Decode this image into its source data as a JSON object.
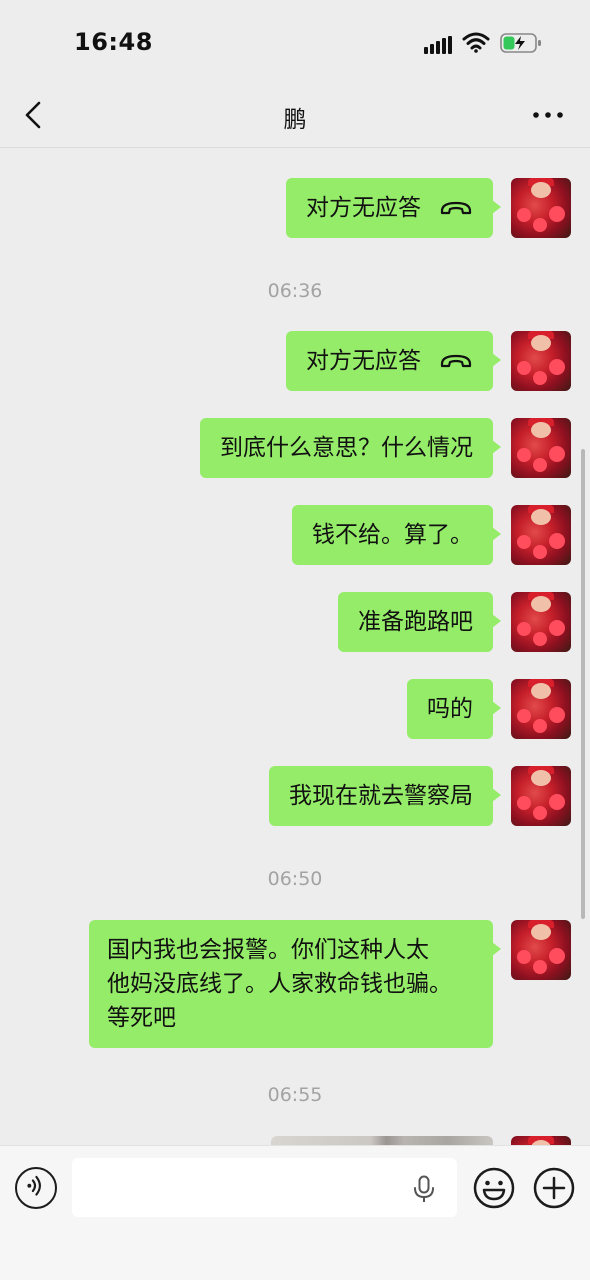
{
  "status_bar": {
    "time": "16:48"
  },
  "nav": {
    "title": "鹏"
  },
  "messages": [
    {
      "type": "call",
      "text": "对方无应答"
    },
    {
      "type": "timestamp",
      "text": "06:36"
    },
    {
      "type": "call",
      "text": "对方无应答"
    },
    {
      "type": "text",
      "text": "到底什么意思？什么情况"
    },
    {
      "type": "text",
      "text": "钱不给。算了。"
    },
    {
      "type": "text",
      "text": "准备跑路吧"
    },
    {
      "type": "text",
      "text": "吗的"
    },
    {
      "type": "text",
      "text": "我现在就去警察局"
    },
    {
      "type": "timestamp",
      "text": "06:50"
    },
    {
      "type": "text",
      "lines": [
        "国内我也会报警。你们这种人太",
        "他妈没底线了。人家救命钱也骗。",
        "等死吧"
      ]
    },
    {
      "type": "timestamp",
      "text": "06:55"
    },
    {
      "type": "image"
    }
  ],
  "colors": {
    "bubble": "#95ec69",
    "background": "#ededed"
  },
  "icons": [
    "back-icon",
    "more-icon",
    "phone-hangup-icon",
    "voice-icon",
    "microphone-icon",
    "emoji-icon",
    "plus-icon"
  ]
}
